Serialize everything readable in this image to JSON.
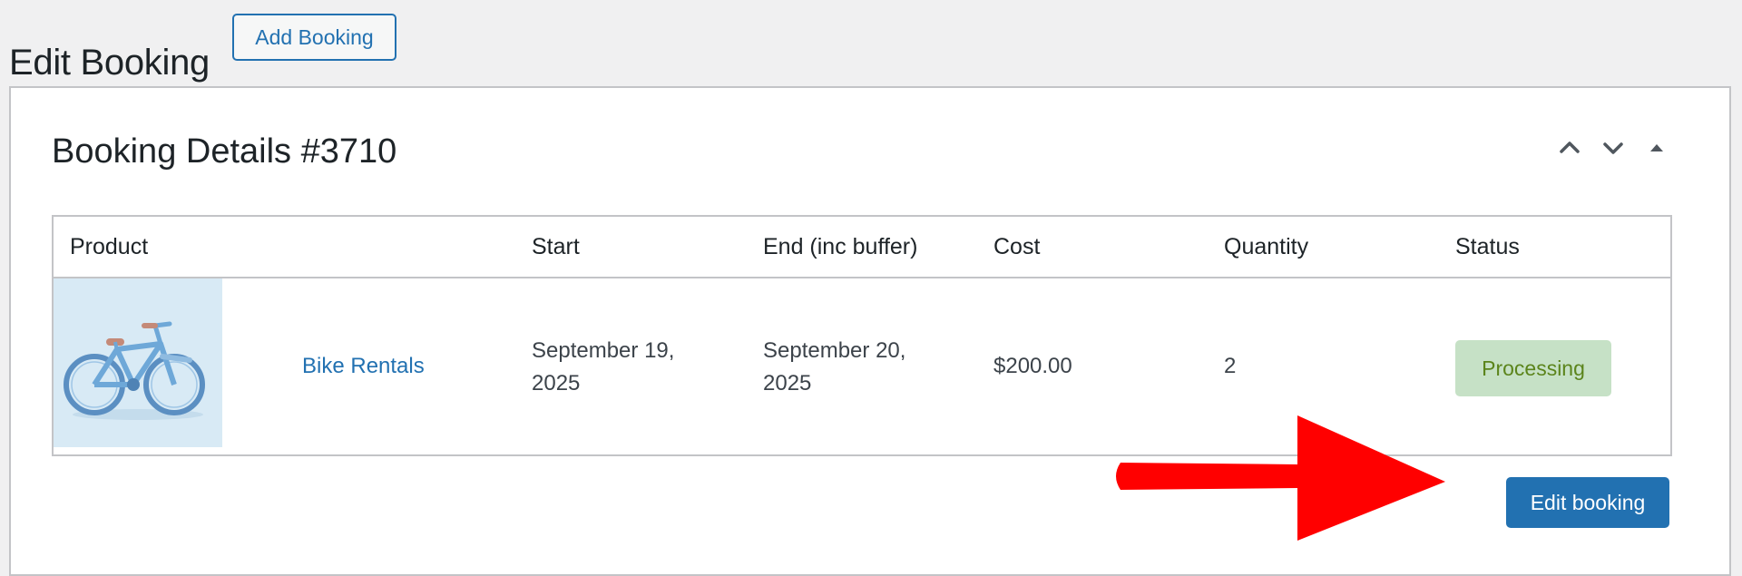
{
  "header": {
    "title": "Edit Booking",
    "add_button_label": "Add Booking"
  },
  "panel": {
    "title": "Booking Details #3710",
    "controls": [
      "chevron-up-icon",
      "chevron-down-icon",
      "triangle-up-icon"
    ]
  },
  "table": {
    "columns": [
      "Product",
      "Start",
      "End (inc buffer)",
      "Cost",
      "Quantity",
      "Status"
    ],
    "rows": [
      {
        "product_image": "bicycle-image",
        "product": "Bike Rentals",
        "start_line1": "September 19,",
        "start_line2": "2025",
        "end_line1": "September 20,",
        "end_line2": "2025",
        "cost": "$200.00",
        "quantity": "2",
        "status": "Processing"
      }
    ]
  },
  "actions": {
    "edit_booking_label": "Edit booking"
  },
  "annotation": {
    "type": "red-arrow",
    "color": "#ff0000"
  },
  "colors": {
    "accent": "#2271b1",
    "status_bg": "#c6e1c6",
    "status_text": "#5b841b"
  }
}
